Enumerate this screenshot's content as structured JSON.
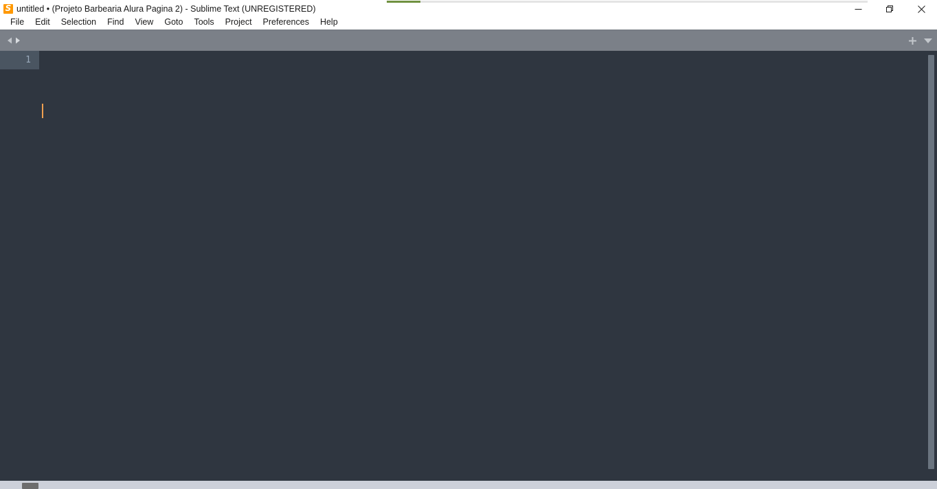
{
  "window": {
    "title": "untitled • (Projeto Barbearia Alura Pagina 2) - Sublime Text (UNREGISTERED)",
    "app_icon": "sublime-text-icon",
    "icon_glyph": "S",
    "controls": {
      "minimize_label": "Minimize",
      "restore_label": "Restore",
      "close_label": "Close"
    }
  },
  "progress_strip": {
    "fill_color": "#6f9140",
    "track_color": "#e4e4e4"
  },
  "menubar": {
    "items": [
      {
        "label": "File"
      },
      {
        "label": "Edit"
      },
      {
        "label": "Selection"
      },
      {
        "label": "Find"
      },
      {
        "label": "View"
      },
      {
        "label": "Goto"
      },
      {
        "label": "Tools"
      },
      {
        "label": "Project"
      },
      {
        "label": "Preferences"
      },
      {
        "label": "Help"
      }
    ]
  },
  "tabbar": {
    "background_color": "#7b8088",
    "nav_prev_icon": "chevron-left-icon",
    "nav_next_icon": "chevron-right-icon",
    "new_tab_icon": "plus-icon",
    "tab_menu_icon": "chevron-down-icon",
    "tabs": []
  },
  "editor": {
    "background_color": "#2f3640",
    "gutter_active_color": "#4a5561",
    "cursor_color": "#f0a050",
    "line_numbers": [
      "1"
    ],
    "content": "",
    "scrollbar": {
      "thumb_color": "#6a747f"
    }
  },
  "taskbar": {
    "background_color": "#ccd0d9"
  }
}
